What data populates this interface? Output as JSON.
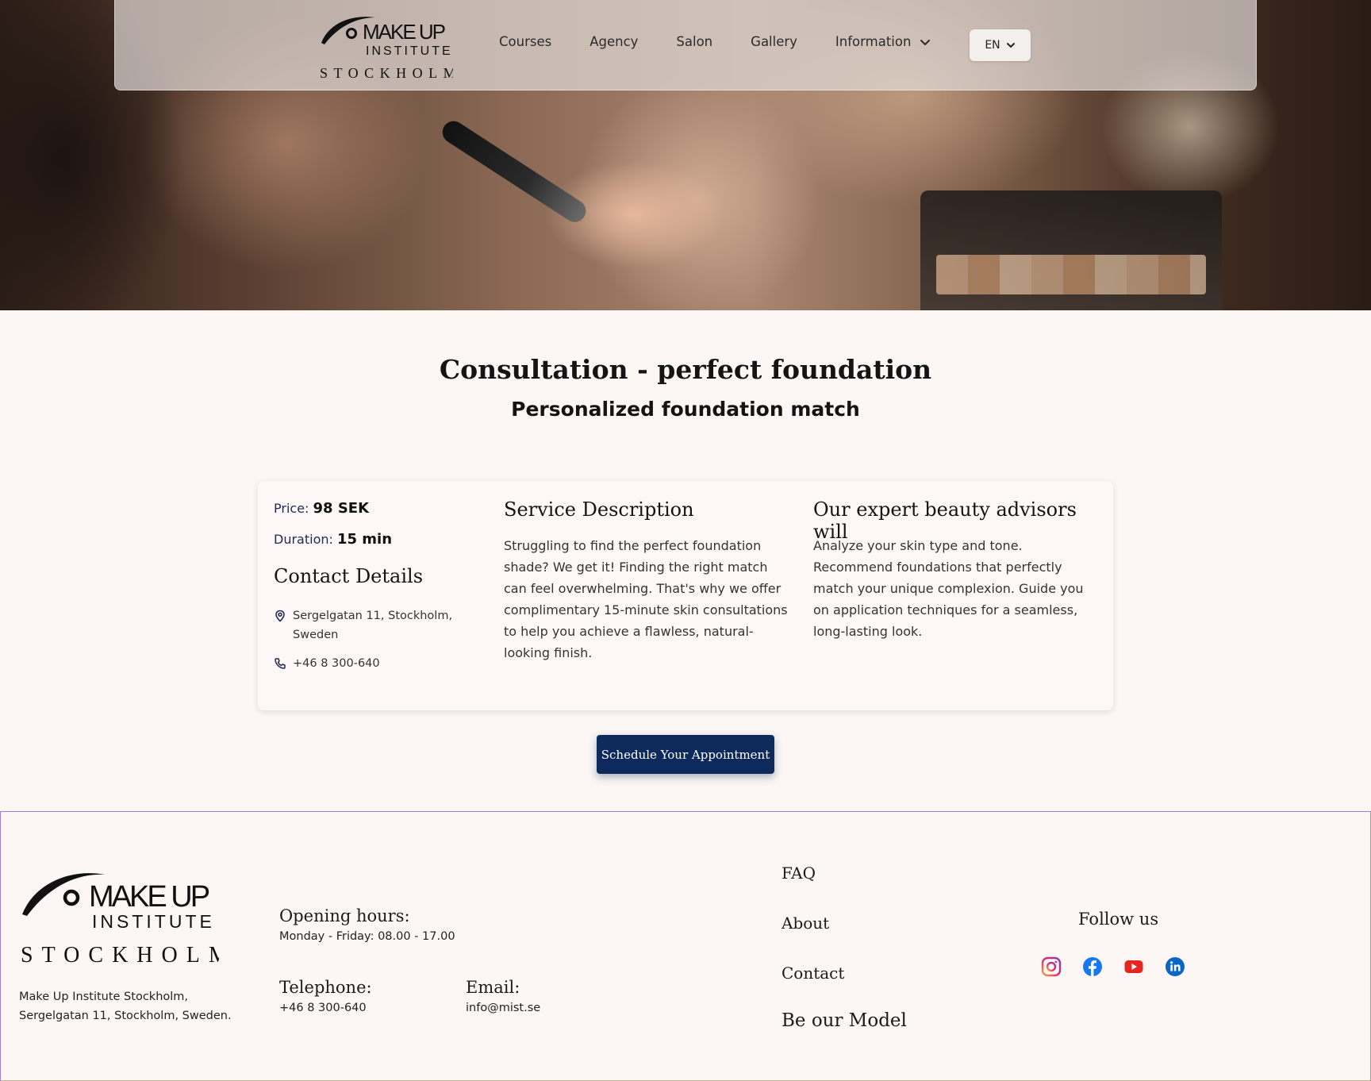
{
  "nav": {
    "logo": {
      "line1": "MAKE UP",
      "line2": "INSTITUTE",
      "line3": "STOCKHOLM"
    },
    "links": [
      {
        "label": "Courses"
      },
      {
        "label": "Agency"
      },
      {
        "label": "Salon"
      },
      {
        "label": "Gallery"
      },
      {
        "label": "Information"
      }
    ],
    "language": "EN"
  },
  "page": {
    "title": "Consultation - perfect foundation",
    "subtitle": "Personalized foundation match"
  },
  "card": {
    "price_label": "Price:",
    "price_value": "98 SEK",
    "duration_label": "Duration:",
    "duration_value": "15 min",
    "contact_heading": "Contact Details",
    "address": "Sergelgatan 11, Stockholm, Sweden",
    "phone": "+46 8 300-640",
    "service_heading": "Service Description",
    "service_text": "Struggling to find the perfect foundation shade? We get it! Finding the right match can feel overwhelming. That's why we offer complimentary 15-minute skin consultations to help you achieve a flawless, natural-looking finish.",
    "advisors_heading": "Our expert beauty advisors will",
    "advisors_text": "Analyze your skin type and tone. Recommend foundations that perfectly match your unique complexion. Guide you on application techniques for a seamless, long-lasting look."
  },
  "cta": {
    "label": "Schedule Your Appointment"
  },
  "footer": {
    "logo": {
      "line1": "MAKE UP",
      "line2": "INSTITUTE",
      "line3": "STOCKHOLM"
    },
    "address": "Make Up Institute Stockholm, Sergelgatan 11, Stockholm, Sweden.",
    "hours_label": "Opening hours:",
    "hours_value": "Monday - Friday: 08.00  - 17.00",
    "telephone_label": "Telephone:",
    "telephone_value": "+46 8 300-640",
    "email_label": "Email:",
    "email_value": "info@mist.se",
    "links": {
      "faq": "FAQ",
      "about": "About",
      "contact": "Contact",
      "model": "Be our Model"
    },
    "follow_label": "Follow us",
    "socials": [
      "instagram-icon",
      "facebook-icon",
      "youtube-icon",
      "linkedin-icon"
    ]
  },
  "colors": {
    "accent": "#0e2a5c",
    "background": "#fcf6f5",
    "facebook": "#1877f2",
    "youtube": "#e52620",
    "linkedin": "#0a66c2"
  }
}
